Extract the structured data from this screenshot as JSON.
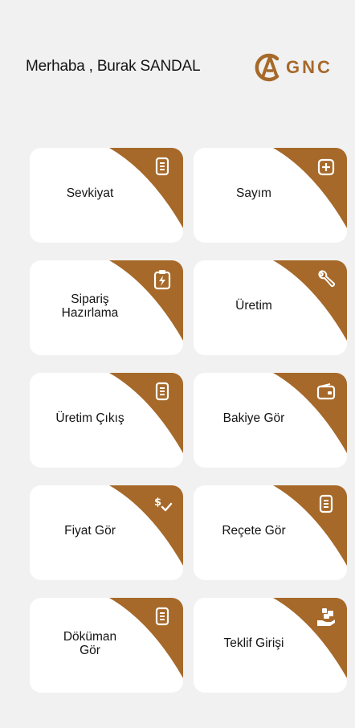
{
  "header": {
    "greeting": "Merhaba  , Burak SANDAL",
    "logo_text": "GNC",
    "logo_mark_icon": "gnc-logo-mark"
  },
  "colors": {
    "accent": "#a6692a",
    "background": "#f1f1f1",
    "card": "#ffffff"
  },
  "menu": [
    {
      "label": "Sevkiyat",
      "icon": "document-icon"
    },
    {
      "label": "Sayım",
      "icon": "plus-box-icon"
    },
    {
      "label": "Sipariş\nHazırlama",
      "icon": "clipboard-bolt-icon"
    },
    {
      "label": "Üretim",
      "icon": "wrench-icon"
    },
    {
      "label": "Üretim Çıkış",
      "icon": "document-icon"
    },
    {
      "label": "Bakiye Gör",
      "icon": "wallet-icon"
    },
    {
      "label": "Fiyat Gör",
      "icon": "price-check-icon"
    },
    {
      "label": "Reçete Gör",
      "icon": "document-icon"
    },
    {
      "label": "Döküman\nGör",
      "icon": "document-icon"
    },
    {
      "label": "Teklif Girişi",
      "icon": "offer-hand-icon"
    }
  ]
}
